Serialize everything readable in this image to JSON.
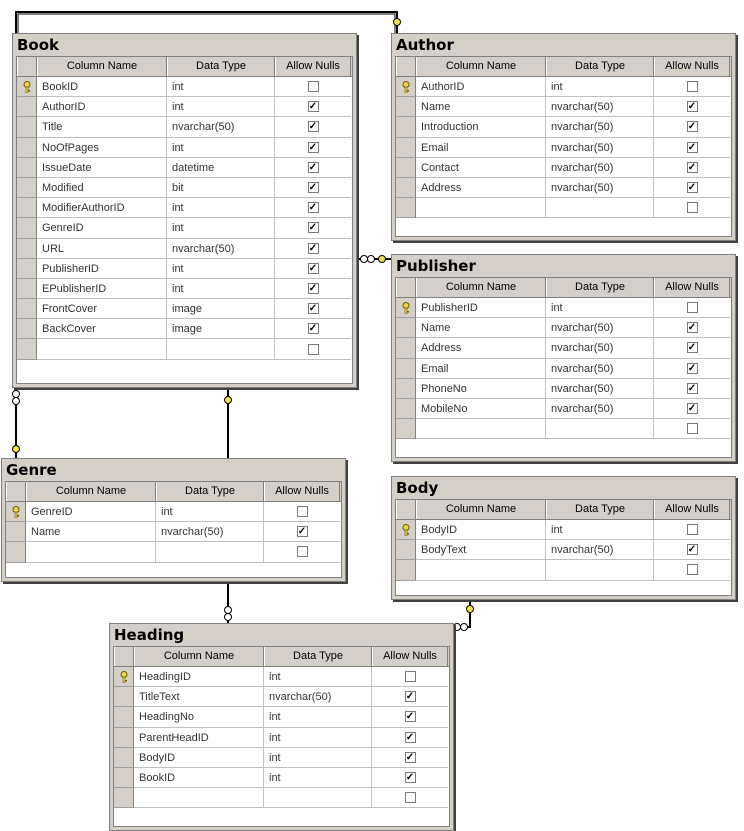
{
  "headers": {
    "column_name": "Column Name",
    "data_type": "Data Type",
    "allow_nulls": "Allow Nulls"
  },
  "tables": [
    {
      "name": "Book",
      "rows": [
        {
          "column": "BookID",
          "type": "int",
          "nulls": false,
          "key": true
        },
        {
          "column": "AuthorID",
          "type": "int",
          "nulls": true,
          "key": false
        },
        {
          "column": "Title",
          "type": "nvarchar(50)",
          "nulls": true,
          "key": false
        },
        {
          "column": "NoOfPages",
          "type": "int",
          "nulls": true,
          "key": false
        },
        {
          "column": "IssueDate",
          "type": "datetime",
          "nulls": true,
          "key": false
        },
        {
          "column": "Modified",
          "type": "bit",
          "nulls": true,
          "key": false
        },
        {
          "column": "ModifierAuthorID",
          "type": "int",
          "nulls": true,
          "key": false
        },
        {
          "column": "GenreID",
          "type": "int",
          "nulls": true,
          "key": false
        },
        {
          "column": "URL",
          "type": "nvarchar(50)",
          "nulls": true,
          "key": false
        },
        {
          "column": "PublisherID",
          "type": "int",
          "nulls": true,
          "key": false
        },
        {
          "column": "EPublisherID",
          "type": "int",
          "nulls": true,
          "key": false
        },
        {
          "column": "FrontCover",
          "type": "image",
          "nulls": true,
          "key": false
        },
        {
          "column": "BackCover",
          "type": "image",
          "nulls": true,
          "key": false
        },
        {
          "column": "",
          "type": "",
          "nulls": false,
          "key": false
        }
      ]
    },
    {
      "name": "Author",
      "rows": [
        {
          "column": "AuthorID",
          "type": "int",
          "nulls": false,
          "key": true
        },
        {
          "column": "Name",
          "type": "nvarchar(50)",
          "nulls": true,
          "key": false
        },
        {
          "column": "Introduction",
          "type": "nvarchar(50)",
          "nulls": true,
          "key": false
        },
        {
          "column": "Email",
          "type": "nvarchar(50)",
          "nulls": true,
          "key": false
        },
        {
          "column": "Contact",
          "type": "nvarchar(50)",
          "nulls": true,
          "key": false
        },
        {
          "column": "Address",
          "type": "nvarchar(50)",
          "nulls": true,
          "key": false
        },
        {
          "column": "",
          "type": "",
          "nulls": false,
          "key": false
        }
      ]
    },
    {
      "name": "Publisher",
      "rows": [
        {
          "column": "PublisherID",
          "type": "int",
          "nulls": false,
          "key": true
        },
        {
          "column": "Name",
          "type": "nvarchar(50)",
          "nulls": true,
          "key": false
        },
        {
          "column": "Address",
          "type": "nvarchar(50)",
          "nulls": true,
          "key": false
        },
        {
          "column": "Email",
          "type": "nvarchar(50)",
          "nulls": true,
          "key": false
        },
        {
          "column": "PhoneNo",
          "type": "nvarchar(50)",
          "nulls": true,
          "key": false
        },
        {
          "column": "MobileNo",
          "type": "nvarchar(50)",
          "nulls": true,
          "key": false
        },
        {
          "column": "",
          "type": "",
          "nulls": false,
          "key": false
        }
      ]
    },
    {
      "name": "Genre",
      "rows": [
        {
          "column": "GenreID",
          "type": "int",
          "nulls": false,
          "key": true
        },
        {
          "column": "Name",
          "type": "nvarchar(50)",
          "nulls": true,
          "key": false
        },
        {
          "column": "",
          "type": "",
          "nulls": false,
          "key": false
        }
      ]
    },
    {
      "name": "Body",
      "rows": [
        {
          "column": "BodyID",
          "type": "int",
          "nulls": false,
          "key": true
        },
        {
          "column": "BodyText",
          "type": "nvarchar(50)",
          "nulls": true,
          "key": false
        },
        {
          "column": "",
          "type": "",
          "nulls": false,
          "key": false
        }
      ]
    },
    {
      "name": "Heading",
      "rows": [
        {
          "column": "HeadingID",
          "type": "int",
          "nulls": false,
          "key": true
        },
        {
          "column": "TitleText",
          "type": "nvarchar(50)",
          "nulls": true,
          "key": false
        },
        {
          "column": "HeadingNo",
          "type": "int",
          "nulls": true,
          "key": false
        },
        {
          "column": "ParentHeadID",
          "type": "int",
          "nulls": true,
          "key": false
        },
        {
          "column": "BodyID",
          "type": "int",
          "nulls": true,
          "key": false
        },
        {
          "column": "BookID",
          "type": "int",
          "nulls": true,
          "key": false
        },
        {
          "column": "",
          "type": "",
          "nulls": false,
          "key": false
        }
      ]
    }
  ],
  "relationships": [
    {
      "from": "Book",
      "to": "Author"
    },
    {
      "from": "Book",
      "to": "Publisher"
    },
    {
      "from": "Book",
      "to": "Genre"
    },
    {
      "from": "Heading",
      "to": "Book"
    },
    {
      "from": "Heading",
      "to": "Body"
    }
  ],
  "colors": {
    "panel": "#d4d0c8",
    "key_icon": "#e8d44d",
    "line": "#000000"
  }
}
